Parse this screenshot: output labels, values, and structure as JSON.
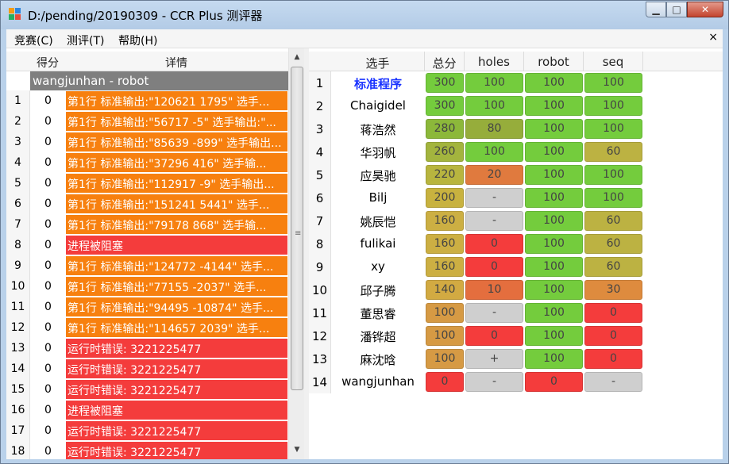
{
  "window": {
    "title": "D:/pending/20190309 - CCR Plus 测评器",
    "min_glyph": "▁",
    "max_glyph": "□",
    "close_glyph": "✕"
  },
  "menu": {
    "items": [
      "竞赛(C)",
      "测评(T)",
      "帮助(H)"
    ],
    "close_glyph": "×"
  },
  "left": {
    "headers": {
      "score": "得分",
      "detail": "详情"
    },
    "group_title": "wangjunhan - robot",
    "rows": [
      {
        "n": "1",
        "score": "0",
        "detail": "第1行 标准输出:\"120621 1795\" 选手...",
        "color": "orange"
      },
      {
        "n": "2",
        "score": "0",
        "detail": "第1行 标准输出:\"56717 -5\" 选手输出:\"...",
        "color": "orange"
      },
      {
        "n": "3",
        "score": "0",
        "detail": "第1行 标准输出:\"85639 -899\" 选手输出...",
        "color": "orange"
      },
      {
        "n": "4",
        "score": "0",
        "detail": "第1行 标准输出:\"37296 416\" 选手输...",
        "color": "orange"
      },
      {
        "n": "5",
        "score": "0",
        "detail": "第1行 标准输出:\"112917 -9\" 选手输出...",
        "color": "orange"
      },
      {
        "n": "6",
        "score": "0",
        "detail": "第1行 标准输出:\"151241 5441\" 选手...",
        "color": "orange"
      },
      {
        "n": "7",
        "score": "0",
        "detail": "第1行 标准输出:\"79178 868\" 选手输...",
        "color": "orange"
      },
      {
        "n": "8",
        "score": "0",
        "detail": "进程被阻塞",
        "color": "red"
      },
      {
        "n": "9",
        "score": "0",
        "detail": "第1行 标准输出:\"124772 -4144\" 选手...",
        "color": "orange"
      },
      {
        "n": "10",
        "score": "0",
        "detail": "第1行 标准输出:\"77155 -2037\" 选手...",
        "color": "orange"
      },
      {
        "n": "11",
        "score": "0",
        "detail": "第1行 标准输出:\"94495 -10874\" 选手...",
        "color": "orange"
      },
      {
        "n": "12",
        "score": "0",
        "detail": "第1行 标准输出:\"114657 2039\" 选手...",
        "color": "orange"
      },
      {
        "n": "13",
        "score": "0",
        "detail": "运行时错误: 3221225477",
        "color": "red"
      },
      {
        "n": "14",
        "score": "0",
        "detail": "运行时错误: 3221225477",
        "color": "red"
      },
      {
        "n": "15",
        "score": "0",
        "detail": "运行时错误: 3221225477",
        "color": "red"
      },
      {
        "n": "16",
        "score": "0",
        "detail": "进程被阻塞",
        "color": "red"
      },
      {
        "n": "17",
        "score": "0",
        "detail": "运行时错误: 3221225477",
        "color": "red"
      },
      {
        "n": "18",
        "score": "0",
        "detail": "运行时错误: 3221225477",
        "color": "red"
      }
    ]
  },
  "scrollbar": {
    "up": "▲",
    "down": "▼",
    "grip": "≡"
  },
  "right": {
    "headers": [
      "选手",
      "总分",
      "holes",
      "robot",
      "seq"
    ],
    "rows": [
      {
        "n": "1",
        "name": "标准程序",
        "bold": true,
        "cells": [
          "300",
          "100",
          "100",
          "100"
        ],
        "colors": [
          "#74cc3d",
          "#74cc3d",
          "#74cc3d",
          "#74cc3d"
        ]
      },
      {
        "n": "2",
        "name": "Chaigidel",
        "cells": [
          "300",
          "100",
          "100",
          "100"
        ],
        "colors": [
          "#74cc3d",
          "#74cc3d",
          "#74cc3d",
          "#74cc3d"
        ]
      },
      {
        "n": "3",
        "name": "蒋浩然",
        "cells": [
          "280",
          "80",
          "100",
          "100"
        ],
        "colors": [
          "#8cb83a",
          "#96ad3b",
          "#74cc3d",
          "#74cc3d"
        ]
      },
      {
        "n": "4",
        "name": "华羽帆",
        "cells": [
          "260",
          "100",
          "100",
          "60"
        ],
        "colors": [
          "#a3b43e",
          "#74cc3d",
          "#74cc3d",
          "#bcb242"
        ]
      },
      {
        "n": "5",
        "name": "应昊驰",
        "cells": [
          "220",
          "20",
          "100",
          "100"
        ],
        "colors": [
          "#b8b53f",
          "#e07a3e",
          "#74cc3d",
          "#74cc3d"
        ]
      },
      {
        "n": "6",
        "name": "Bilj",
        "cells": [
          "200",
          "-",
          "100",
          "100"
        ],
        "colors": [
          "#c8b23f",
          "#cfcfcf",
          "#74cc3d",
          "#74cc3d"
        ]
      },
      {
        "n": "7",
        "name": "姚辰恺",
        "cells": [
          "160",
          "-",
          "100",
          "60"
        ],
        "colors": [
          "#ccaf43",
          "#cfcfcf",
          "#74cc3d",
          "#bcb242"
        ]
      },
      {
        "n": "8",
        "name": "fulikai",
        "cells": [
          "160",
          "0",
          "100",
          "60"
        ],
        "colors": [
          "#ccaf43",
          "#f43c3c",
          "#74cc3d",
          "#bcb242"
        ]
      },
      {
        "n": "9",
        "name": "xy",
        "cells": [
          "160",
          "0",
          "100",
          "60"
        ],
        "colors": [
          "#ccaf43",
          "#f43c3c",
          "#74cc3d",
          "#bcb242"
        ]
      },
      {
        "n": "10",
        "name": "邱子腾",
        "cells": [
          "140",
          "10",
          "100",
          "30"
        ],
        "colors": [
          "#d2aa42",
          "#e46e3e",
          "#74cc3d",
          "#de8b3e"
        ]
      },
      {
        "n": "11",
        "name": "董思睿",
        "cells": [
          "100",
          "-",
          "100",
          "0"
        ],
        "colors": [
          "#d69a44",
          "#cfcfcf",
          "#74cc3d",
          "#f43c3c"
        ]
      },
      {
        "n": "12",
        "name": "潘铧超",
        "cells": [
          "100",
          "0",
          "100",
          "0"
        ],
        "colors": [
          "#d69a44",
          "#f43c3c",
          "#74cc3d",
          "#f43c3c"
        ]
      },
      {
        "n": "13",
        "name": "麻沈晗",
        "cells": [
          "100",
          "+",
          "100",
          "0"
        ],
        "colors": [
          "#d69a44",
          "#cfcfcf",
          "#74cc3d",
          "#f43c3c"
        ]
      },
      {
        "n": "14",
        "name": "wangjunhan",
        "cells": [
          "0",
          "-",
          "0",
          "-"
        ],
        "colors": [
          "#f43c3c",
          "#cfcfcf",
          "#f43c3c",
          "#cfcfcf"
        ]
      }
    ]
  }
}
